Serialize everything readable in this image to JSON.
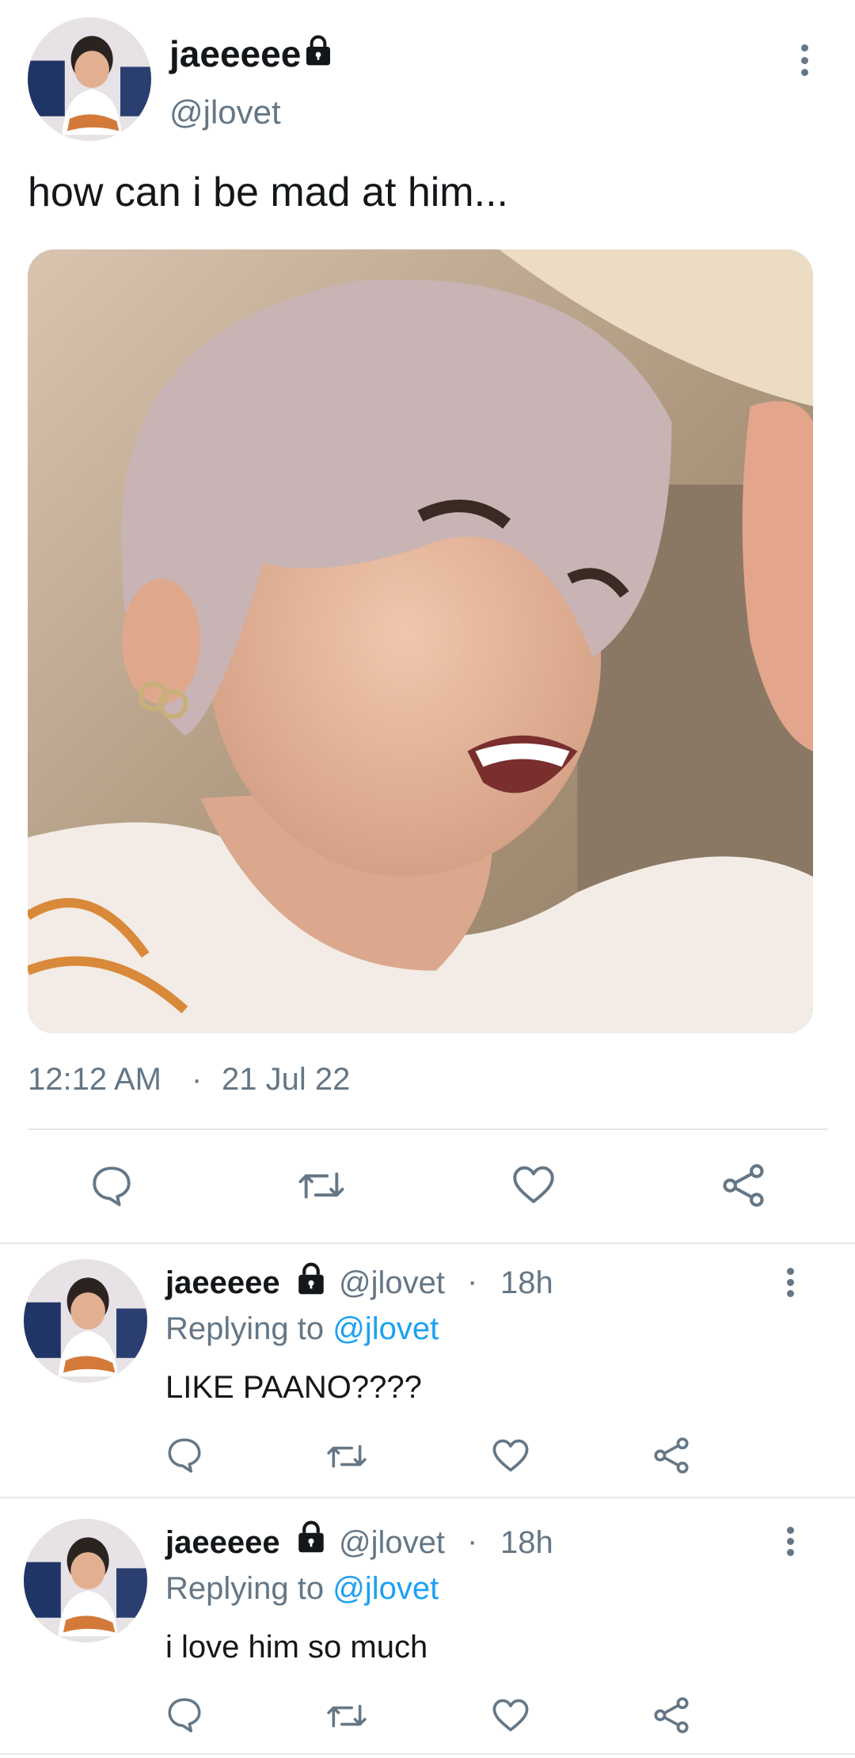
{
  "main_tweet": {
    "display_name": "jaeeeee",
    "handle": "@jlovet",
    "text": "how can i be mad at him...",
    "time": "12:12 AM",
    "separator": "·",
    "date": "21 Jul 22",
    "icons": [
      "lock-icon",
      "more-icon",
      "reply-icon",
      "retweet-icon",
      "like-icon",
      "share-icon"
    ]
  },
  "replies": [
    {
      "display_name": "jaeeeee",
      "handle": "@jlovet",
      "dot": "·",
      "age": "18h",
      "replying_prefix": "Replying to",
      "replying_to": "@jlovet",
      "text": "LIKE PAANO????"
    },
    {
      "display_name": "jaeeeee",
      "handle": "@jlovet",
      "dot": "·",
      "age": "18h",
      "replying_prefix": "Replying to",
      "replying_to": "@jlovet",
      "text": "i love him so much"
    }
  ],
  "colors": {
    "text": "#14171a",
    "secondary": "#657786",
    "link": "#1da1f2",
    "divider": "#e1e8ed"
  }
}
